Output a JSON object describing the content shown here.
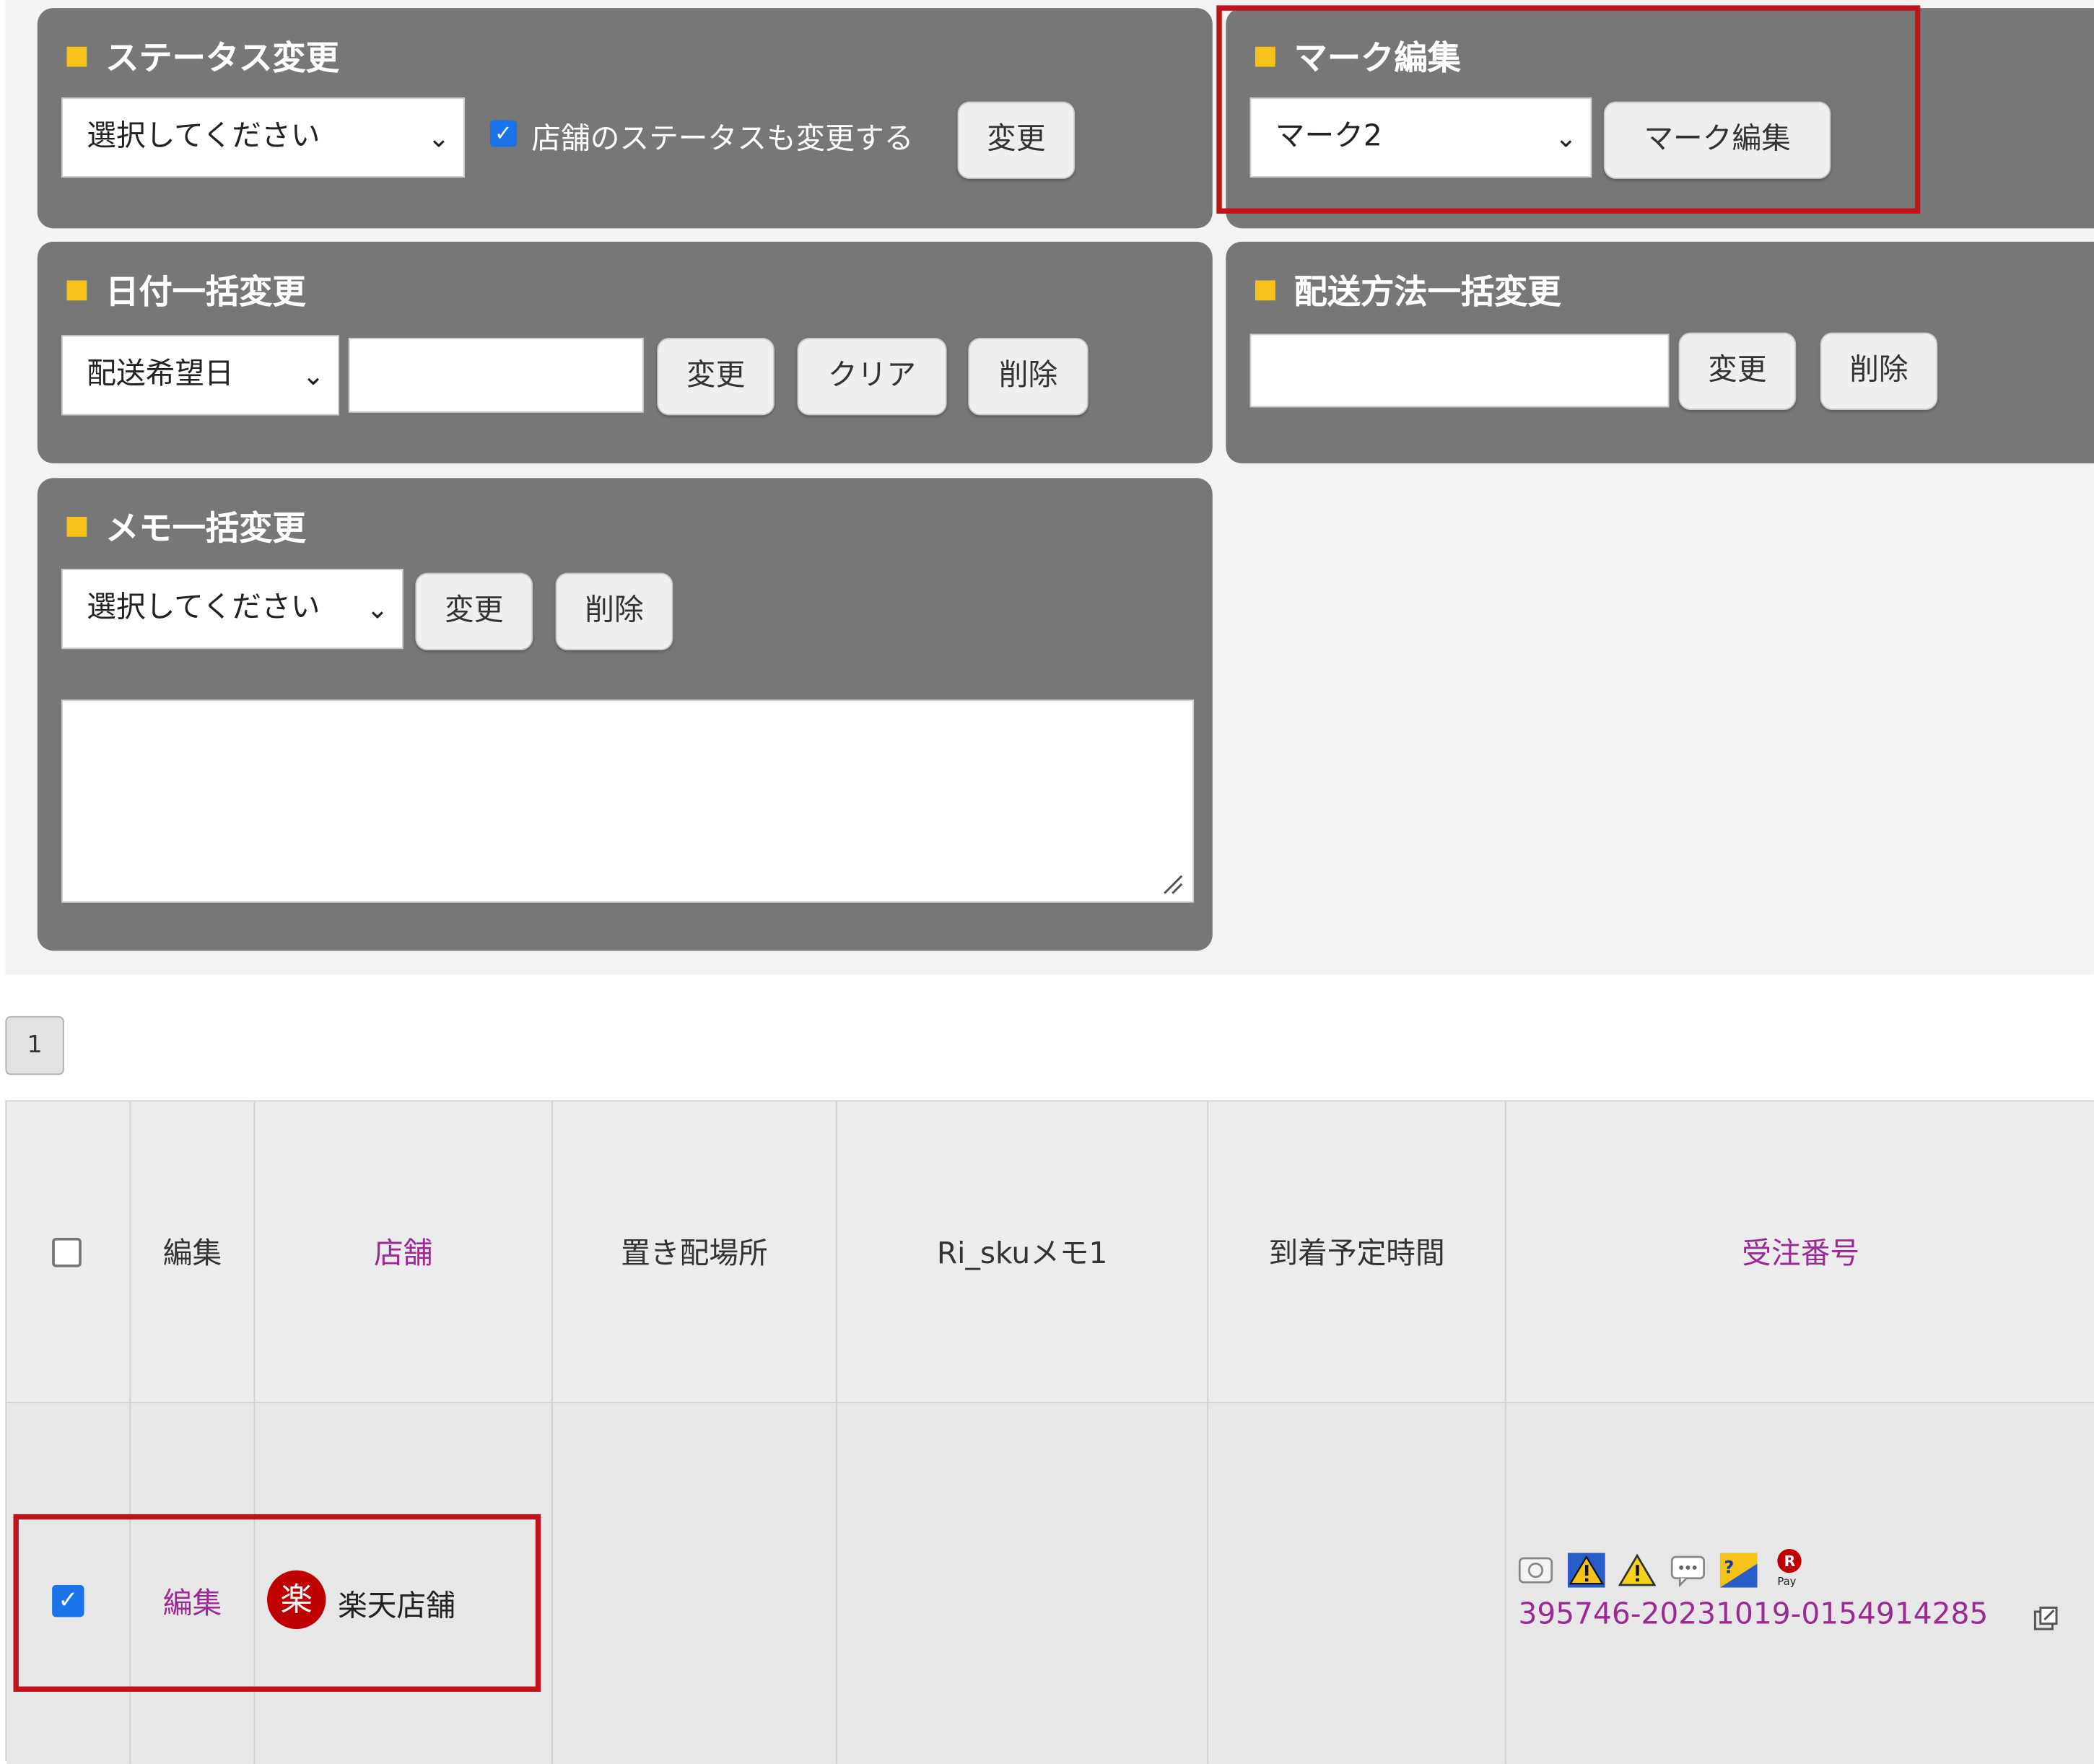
{
  "status_panel": {
    "title": "ステータス変更",
    "select_value": "選択してください",
    "checkbox_label": "店舗のステータスも変更する",
    "change_label": "変更"
  },
  "mark_panel": {
    "title": "マーク編集",
    "select_value": "マーク2",
    "edit_label": "マーク編集"
  },
  "date_panel": {
    "title": "日付一括変更",
    "select_value": "配送希望日",
    "input_value": "",
    "change_label": "変更",
    "clear_label": "クリア",
    "delete_label": "削除"
  },
  "shipping_panel": {
    "title": "配送方法一括変更",
    "input_value": "",
    "change_label": "変更",
    "delete_label": "削除"
  },
  "memo_panel": {
    "title": "メモ一括変更",
    "select_value": "選択してください",
    "change_label": "変更",
    "delete_label": "削除",
    "textarea_value": ""
  },
  "pagination": {
    "current_page": "1"
  },
  "table": {
    "headers": [
      "",
      "編集",
      "店舗",
      "置き配場所",
      "Ri_skuメモ1",
      "到着予定時間",
      "受注番号"
    ],
    "rows": [
      {
        "checked": true,
        "edit_label": "編集",
        "shop_logo_char": "楽",
        "shop_name": "楽天店舗",
        "placement": "",
        "sku_memo": "",
        "arrival_time": "",
        "order_number": "395746-20231019-0154914285",
        "order_icons": [
          "mail-icon",
          "warning-blue-icon",
          "warning-yellow-icon",
          "comment-icon",
          "payment-icon",
          "rakuten-pay-icon"
        ]
      }
    ]
  },
  "colors": {
    "panel_bg": "#777777",
    "title_square": "#f6c21a",
    "highlight_red": "#c0141c",
    "link_purple": "#9b2a92",
    "checkbox_blue": "#1a73e8"
  }
}
